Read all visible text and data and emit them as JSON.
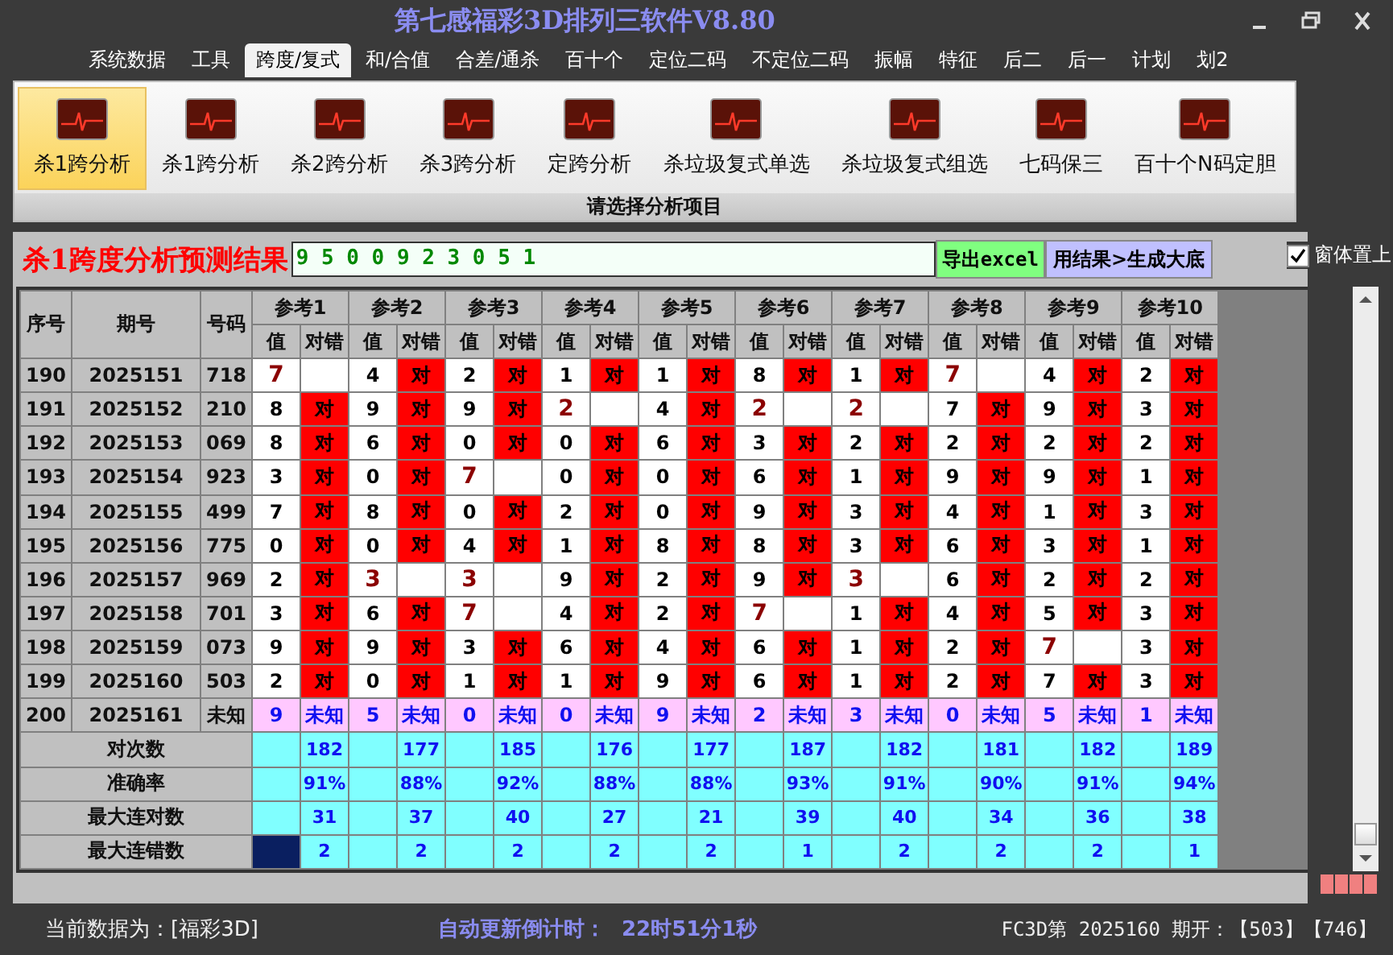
{
  "window": {
    "title": "第七感福彩3D排列三软件V8.80"
  },
  "menu_tabs": [
    {
      "label": "系统数据",
      "selected": false
    },
    {
      "label": "工具",
      "selected": false
    },
    {
      "label": "跨度/复式",
      "selected": true
    },
    {
      "label": "和/合值",
      "selected": false
    },
    {
      "label": "合差/通杀",
      "selected": false
    },
    {
      "label": "百十个",
      "selected": false
    },
    {
      "label": "定位二码",
      "selected": false
    },
    {
      "label": "不定位二码",
      "selected": false
    },
    {
      "label": "振幅",
      "selected": false
    },
    {
      "label": "特征",
      "selected": false
    },
    {
      "label": "后二",
      "selected": false
    },
    {
      "label": "后一",
      "selected": false
    },
    {
      "label": "计划",
      "selected": false
    },
    {
      "label": "划2",
      "selected": false
    }
  ],
  "ribbon": {
    "caption": "请选择分析项目",
    "items": [
      {
        "label": "杀1跨分析",
        "selected": true
      },
      {
        "label": "杀1跨分析",
        "selected": false
      },
      {
        "label": "杀2跨分析",
        "selected": false
      },
      {
        "label": "杀3跨分析",
        "selected": false
      },
      {
        "label": "定跨分析",
        "selected": false
      },
      {
        "label": "杀垃圾复式单选",
        "selected": false
      },
      {
        "label": "杀垃圾复式组选",
        "selected": false
      },
      {
        "label": "七码保三",
        "selected": false
      },
      {
        "label": "百十个N码定胆",
        "selected": false
      }
    ]
  },
  "result": {
    "title": "杀1跨度分析预测结果",
    "value": "9 5 0 0 9 2 3 0 5 1",
    "export_button": "导出excel",
    "generate_button": "用结果>生成大底",
    "stay_on_top": {
      "label": "窗体置上",
      "checked": true
    }
  },
  "table": {
    "columns": [
      "序号",
      "期号",
      "号码"
    ],
    "ref_headers": [
      {
        "label": "参考1",
        "sub": [
          "值",
          "对错"
        ]
      },
      {
        "label": "参考2",
        "sub": [
          "值",
          "对错"
        ]
      },
      {
        "label": "参考3",
        "sub": [
          "值",
          "对错"
        ]
      },
      {
        "label": "参考4",
        "sub": [
          "值",
          "对错"
        ]
      },
      {
        "label": "参考5",
        "sub": [
          "值",
          "对错"
        ]
      },
      {
        "label": "参考6",
        "sub": [
          "值",
          "对错"
        ]
      },
      {
        "label": "参考7",
        "sub": [
          "值",
          "对错"
        ]
      },
      {
        "label": "参考8",
        "sub": [
          "值",
          "对错"
        ]
      },
      {
        "label": "参考9",
        "sub": [
          "值",
          "对错"
        ]
      },
      {
        "label": "参考10",
        "sub": [
          "值",
          "对错"
        ]
      }
    ],
    "rows": [
      {
        "kind": "history",
        "seq": "190",
        "issue": "2025151",
        "number": "718",
        "cells": [
          {
            "value": "7"
          },
          {
            "value": "4",
            "result": "对"
          },
          {
            "value": "2",
            "result": "对"
          },
          {
            "value": "1",
            "result": "对"
          },
          {
            "value": "1",
            "result": "对"
          },
          {
            "value": "8",
            "result": "对"
          },
          {
            "value": "1",
            "result": "对"
          },
          {
            "value": "7"
          },
          {
            "value": "4",
            "result": "对"
          },
          {
            "value": "2",
            "result": "对"
          }
        ]
      },
      {
        "kind": "history",
        "seq": "191",
        "issue": "2025152",
        "number": "210",
        "cells": [
          {
            "value": "8",
            "result": "对"
          },
          {
            "value": "9",
            "result": "对"
          },
          {
            "value": "9",
            "result": "对"
          },
          {
            "value": "2"
          },
          {
            "value": "4",
            "result": "对"
          },
          {
            "value": "2"
          },
          {
            "value": "2"
          },
          {
            "value": "7",
            "result": "对"
          },
          {
            "value": "9",
            "result": "对"
          },
          {
            "value": "3",
            "result": "对"
          }
        ]
      },
      {
        "kind": "history",
        "seq": "192",
        "issue": "2025153",
        "number": "069",
        "cells": [
          {
            "value": "8",
            "result": "对"
          },
          {
            "value": "6",
            "result": "对"
          },
          {
            "value": "0",
            "result": "对"
          },
          {
            "value": "0",
            "result": "对"
          },
          {
            "value": "6",
            "result": "对"
          },
          {
            "value": "3",
            "result": "对"
          },
          {
            "value": "2",
            "result": "对"
          },
          {
            "value": "2",
            "result": "对"
          },
          {
            "value": "2",
            "result": "对"
          },
          {
            "value": "2",
            "result": "对"
          }
        ]
      },
      {
        "kind": "history",
        "seq": "193",
        "issue": "2025154",
        "number": "923",
        "cells": [
          {
            "value": "3",
            "result": "对"
          },
          {
            "value": "0",
            "result": "对"
          },
          {
            "value": "7"
          },
          {
            "value": "0",
            "result": "对"
          },
          {
            "value": "0",
            "result": "对"
          },
          {
            "value": "6",
            "result": "对"
          },
          {
            "value": "1",
            "result": "对"
          },
          {
            "value": "9",
            "result": "对"
          },
          {
            "value": "9",
            "result": "对"
          },
          {
            "value": "1",
            "result": "对"
          }
        ]
      },
      {
        "kind": "history",
        "seq": "194",
        "issue": "2025155",
        "number": "499",
        "cells": [
          {
            "value": "7",
            "result": "对"
          },
          {
            "value": "8",
            "result": "对"
          },
          {
            "value": "0",
            "result": "对"
          },
          {
            "value": "2",
            "result": "对"
          },
          {
            "value": "0",
            "result": "对"
          },
          {
            "value": "9",
            "result": "对"
          },
          {
            "value": "3",
            "result": "对"
          },
          {
            "value": "4",
            "result": "对"
          },
          {
            "value": "1",
            "result": "对"
          },
          {
            "value": "3",
            "result": "对"
          }
        ]
      },
      {
        "kind": "history",
        "seq": "195",
        "issue": "2025156",
        "number": "775",
        "cells": [
          {
            "value": "0",
            "result": "对"
          },
          {
            "value": "0",
            "result": "对"
          },
          {
            "value": "4",
            "result": "对"
          },
          {
            "value": "1",
            "result": "对"
          },
          {
            "value": "8",
            "result": "对"
          },
          {
            "value": "8",
            "result": "对"
          },
          {
            "value": "3",
            "result": "对"
          },
          {
            "value": "6",
            "result": "对"
          },
          {
            "value": "3",
            "result": "对"
          },
          {
            "value": "1",
            "result": "对"
          }
        ]
      },
      {
        "kind": "history",
        "seq": "196",
        "issue": "2025157",
        "number": "969",
        "cells": [
          {
            "value": "2",
            "result": "对"
          },
          {
            "value": "3"
          },
          {
            "value": "3"
          },
          {
            "value": "9",
            "result": "对"
          },
          {
            "value": "2",
            "result": "对"
          },
          {
            "value": "9",
            "result": "对"
          },
          {
            "value": "3"
          },
          {
            "value": "6",
            "result": "对"
          },
          {
            "value": "2",
            "result": "对"
          },
          {
            "value": "2",
            "result": "对"
          }
        ]
      },
      {
        "kind": "history",
        "seq": "197",
        "issue": "2025158",
        "number": "701",
        "cells": [
          {
            "value": "3",
            "result": "对"
          },
          {
            "value": "6",
            "result": "对"
          },
          {
            "value": "7"
          },
          {
            "value": "4",
            "result": "对"
          },
          {
            "value": "2",
            "result": "对"
          },
          {
            "value": "7"
          },
          {
            "value": "1",
            "result": "对"
          },
          {
            "value": "4",
            "result": "对"
          },
          {
            "value": "5",
            "result": "对"
          },
          {
            "value": "3",
            "result": "对"
          }
        ]
      },
      {
        "kind": "history",
        "seq": "198",
        "issue": "2025159",
        "number": "073",
        "cells": [
          {
            "value": "9",
            "result": "对"
          },
          {
            "value": "9",
            "result": "对"
          },
          {
            "value": "3",
            "result": "对"
          },
          {
            "value": "6",
            "result": "对"
          },
          {
            "value": "4",
            "result": "对"
          },
          {
            "value": "6",
            "result": "对"
          },
          {
            "value": "1",
            "result": "对"
          },
          {
            "value": "2",
            "result": "对"
          },
          {
            "value": "7"
          },
          {
            "value": "3",
            "result": "对"
          }
        ]
      },
      {
        "kind": "history",
        "seq": "199",
        "issue": "2025160",
        "number": "503",
        "cells": [
          {
            "value": "2",
            "result": "对"
          },
          {
            "value": "0",
            "result": "对"
          },
          {
            "value": "1",
            "result": "对"
          },
          {
            "value": "1",
            "result": "对"
          },
          {
            "value": "9",
            "result": "对"
          },
          {
            "value": "6",
            "result": "对"
          },
          {
            "value": "1",
            "result": "对"
          },
          {
            "value": "2",
            "result": "对"
          },
          {
            "value": "7",
            "result": "对"
          },
          {
            "value": "3",
            "result": "对"
          }
        ]
      },
      {
        "kind": "pending",
        "seq": "200",
        "issue": "2025161",
        "number": "未知",
        "cells": [
          {
            "value": "9",
            "result": "未知"
          },
          {
            "value": "5",
            "result": "未知"
          },
          {
            "value": "0",
            "result": "未知"
          },
          {
            "value": "0",
            "result": "未知"
          },
          {
            "value": "9",
            "result": "未知"
          },
          {
            "value": "2",
            "result": "未知"
          },
          {
            "value": "3",
            "result": "未知"
          },
          {
            "value": "0",
            "result": "未知"
          },
          {
            "value": "5",
            "result": "未知"
          },
          {
            "value": "1",
            "result": "未知"
          }
        ]
      }
    ],
    "summary": [
      {
        "label": "对次数",
        "selected": false,
        "values": [
          "182",
          "177",
          "185",
          "176",
          "177",
          "187",
          "182",
          "181",
          "182",
          "189"
        ]
      },
      {
        "label": "准确率",
        "selected": false,
        "values": [
          "91%",
          "88%",
          "92%",
          "88%",
          "88%",
          "93%",
          "91%",
          "90%",
          "91%",
          "94%"
        ]
      },
      {
        "label": "最大连对数",
        "selected": false,
        "values": [
          "31",
          "37",
          "40",
          "27",
          "21",
          "39",
          "40",
          "34",
          "36",
          "38"
        ]
      },
      {
        "label": "最大连错数",
        "selected": true,
        "values": [
          "2",
          "2",
          "2",
          "2",
          "2",
          "1",
          "2",
          "2",
          "2",
          "1"
        ]
      }
    ]
  },
  "status_bar": {
    "data_source": "当前数据为：[福彩3D]",
    "countdown_label": "自动更新倒计时：",
    "countdown": "22时51分1秒",
    "latest": "FC3D第 2025160 期开：【503】【746】"
  }
}
